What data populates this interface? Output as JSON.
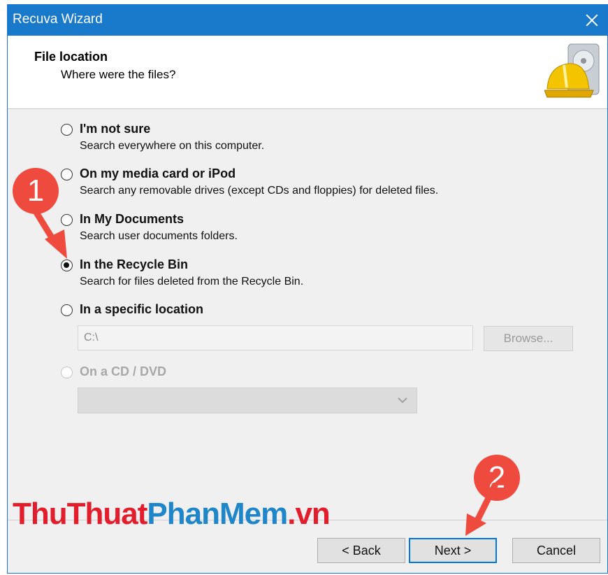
{
  "window": {
    "title": "Recuva Wizard"
  },
  "header": {
    "title": "File location",
    "subtitle": "Where were the files?"
  },
  "options": [
    {
      "label": "I'm not sure",
      "description": "Search everywhere on this computer.",
      "checked": false,
      "disabled": false
    },
    {
      "label": "On my media card or iPod",
      "description": "Search any removable drives (except CDs and floppies) for deleted files.",
      "checked": false,
      "disabled": false
    },
    {
      "label": "In My Documents",
      "description": "Search user documents folders.",
      "checked": false,
      "disabled": false
    },
    {
      "label": "In the Recycle Bin",
      "description": "Search for files deleted from the Recycle Bin.",
      "checked": true,
      "disabled": false
    },
    {
      "label": "In a specific location",
      "description": "",
      "checked": false,
      "disabled": false
    },
    {
      "label": "On a CD / DVD",
      "description": "",
      "checked": false,
      "disabled": true
    }
  ],
  "location": {
    "path": "C:\\",
    "browse_label": "Browse..."
  },
  "cd_dvd": {
    "selected": ""
  },
  "buttons": {
    "back": "< Back",
    "next": "Next >",
    "cancel": "Cancel"
  },
  "watermark": {
    "part1": "ThuThuat",
    "part2": "PhanMem",
    "part3": ".vn"
  },
  "annotations": {
    "step1": "1",
    "step2": "2"
  },
  "colors": {
    "titlebar": "#1979ca",
    "badge": "#ef4a3e",
    "primary_border": "#0078d7"
  },
  "icons": {
    "close": "close-icon",
    "logo": "recuva-hardhat-logo-icon",
    "dropdown": "chevron-down-icon"
  }
}
